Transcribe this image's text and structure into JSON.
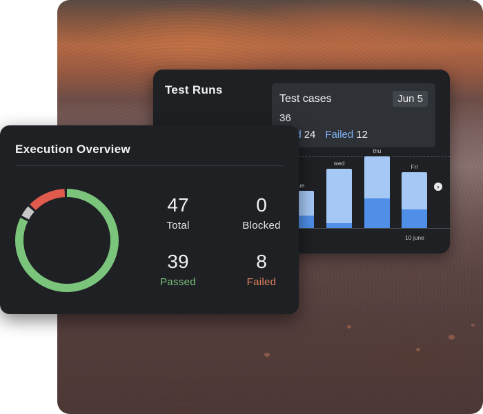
{
  "colors": {
    "card_bg": "#1e2024",
    "passed": "#7bc47b",
    "failed": "#e05a4e",
    "blocked": "#c7c7c7",
    "bar_light": "#a5c8f5",
    "bar_dark": "#4f8fe8"
  },
  "test_runs": {
    "title": "Test Runs",
    "tooltip": {
      "title": "Test cases",
      "date": "Jun 5",
      "total": "36",
      "passed_label": "ssed",
      "passed_value": "24",
      "failed_label": "Failed",
      "failed_value": "12"
    },
    "next_icon": "chevron-right-icon",
    "date_label": "10 june",
    "bars": [
      {
        "day": "ue",
        "total": 30,
        "passed": 10
      },
      {
        "day": "wed",
        "total": 48,
        "passed": 4
      },
      {
        "day": "thu",
        "total": 58,
        "passed": 24
      },
      {
        "day": "Fri",
        "total": 45,
        "passed": 15
      }
    ]
  },
  "execution_overview": {
    "title": "Execution Overview",
    "total": {
      "value": "47",
      "label": "Total"
    },
    "blocked": {
      "value": "0",
      "label": "Blocked"
    },
    "passed": {
      "value": "39",
      "label": "Passed"
    },
    "failed": {
      "value": "8",
      "label": "Failed"
    },
    "donut_segments": [
      {
        "name": "passed",
        "value": 39
      },
      {
        "name": "blocked",
        "value": 2
      },
      {
        "name": "failed",
        "value": 6
      }
    ]
  }
}
